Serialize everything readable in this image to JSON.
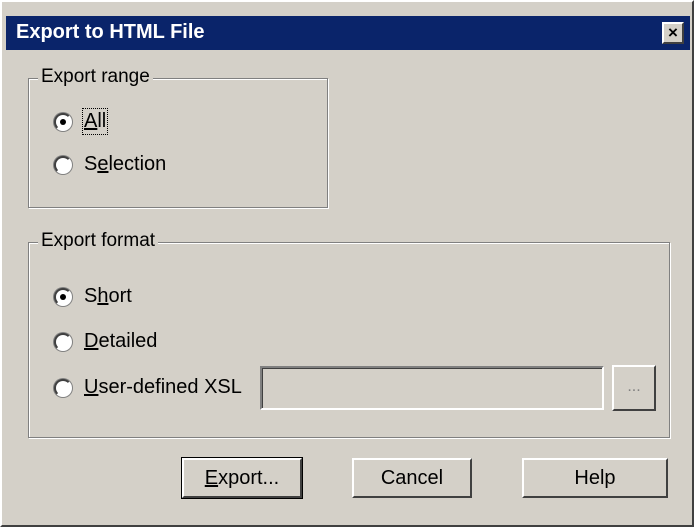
{
  "dialog": {
    "title": "Export to HTML File",
    "close_label": "×"
  },
  "export_range": {
    "legend": "Export range",
    "options": [
      {
        "label_u": "A",
        "label_rest": "ll",
        "selected": true
      },
      {
        "label_pre": "S",
        "label_u": "e",
        "label_rest": "lection",
        "selected": false
      }
    ]
  },
  "export_format": {
    "legend": "Export format",
    "options": [
      {
        "label_pre": "S",
        "label_u": "h",
        "label_rest": "ort",
        "selected": true
      },
      {
        "label_u": "D",
        "label_rest": "etailed",
        "selected": false
      },
      {
        "label_u": "U",
        "label_rest": "ser-defined XSL",
        "selected": false
      }
    ],
    "xsl_path": "",
    "browse_label": "..."
  },
  "buttons": {
    "export_u": "E",
    "export_rest": "xport...",
    "cancel": "Cancel",
    "help": "Help"
  }
}
